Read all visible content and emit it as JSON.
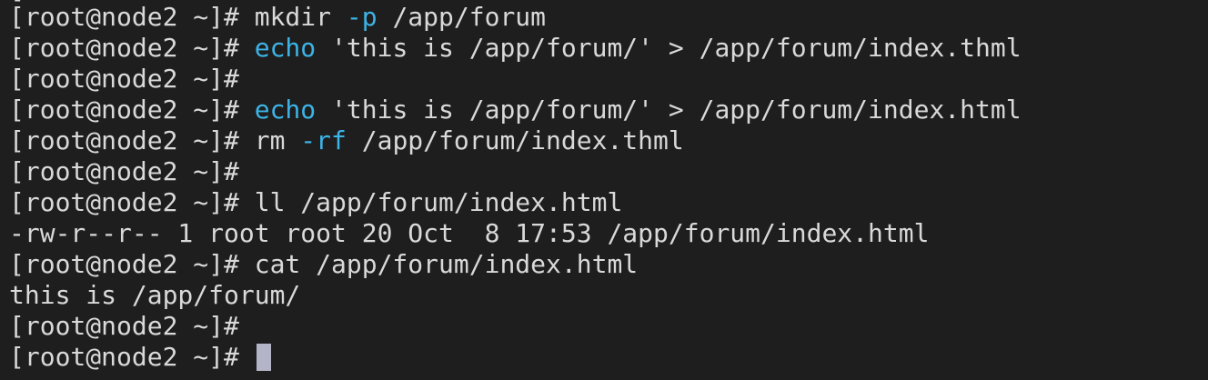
{
  "colors": {
    "background": "#1e1e1e",
    "foreground": "#d9d9d9",
    "command_keyword": "#3cb4e6",
    "cursor": "#b4b4c8"
  },
  "terminal": {
    "partial_top_line": "[",
    "lines": [
      {
        "segments": [
          {
            "text": "[root@node2 ~]# mkdir ",
            "color": "#d9d9d9"
          },
          {
            "text": "-p",
            "color": "#3cb4e6"
          },
          {
            "text": " /app/forum",
            "color": "#d9d9d9"
          }
        ]
      },
      {
        "segments": [
          {
            "text": "[root@node2 ~]# ",
            "color": "#d9d9d9"
          },
          {
            "text": "echo",
            "color": "#3cb4e6"
          },
          {
            "text": " 'this is /app/forum/' > /app/forum/index.thml",
            "color": "#d9d9d9"
          }
        ]
      },
      {
        "segments": [
          {
            "text": "[root@node2 ~]#",
            "color": "#d9d9d9"
          }
        ]
      },
      {
        "segments": [
          {
            "text": "[root@node2 ~]# ",
            "color": "#d9d9d9"
          },
          {
            "text": "echo",
            "color": "#3cb4e6"
          },
          {
            "text": " 'this is /app/forum/' > /app/forum/index.html",
            "color": "#d9d9d9"
          }
        ]
      },
      {
        "segments": [
          {
            "text": "[root@node2 ~]# rm ",
            "color": "#d9d9d9"
          },
          {
            "text": "-rf",
            "color": "#3cb4e6"
          },
          {
            "text": " /app/forum/index.thml",
            "color": "#d9d9d9"
          }
        ]
      },
      {
        "segments": [
          {
            "text": "[root@node2 ~]#",
            "color": "#d9d9d9"
          }
        ]
      },
      {
        "segments": [
          {
            "text": "[root@node2 ~]# ll /app/forum/index.html",
            "color": "#d9d9d9"
          }
        ]
      },
      {
        "segments": [
          {
            "text": "-rw-r--r-- 1 root root 20 Oct  8 17:53 /app/forum/index.html",
            "color": "#d9d9d9"
          }
        ]
      },
      {
        "segments": [
          {
            "text": "[root@node2 ~]# cat /app/forum/index.html",
            "color": "#d9d9d9"
          }
        ]
      },
      {
        "segments": [
          {
            "text": "this is /app/forum/",
            "color": "#d9d9d9"
          }
        ]
      },
      {
        "segments": [
          {
            "text": "[root@node2 ~]#",
            "color": "#d9d9d9"
          }
        ]
      },
      {
        "segments": [
          {
            "text": "[root@node2 ~]# ",
            "color": "#d9d9d9"
          }
        ],
        "cursor": true
      }
    ]
  }
}
